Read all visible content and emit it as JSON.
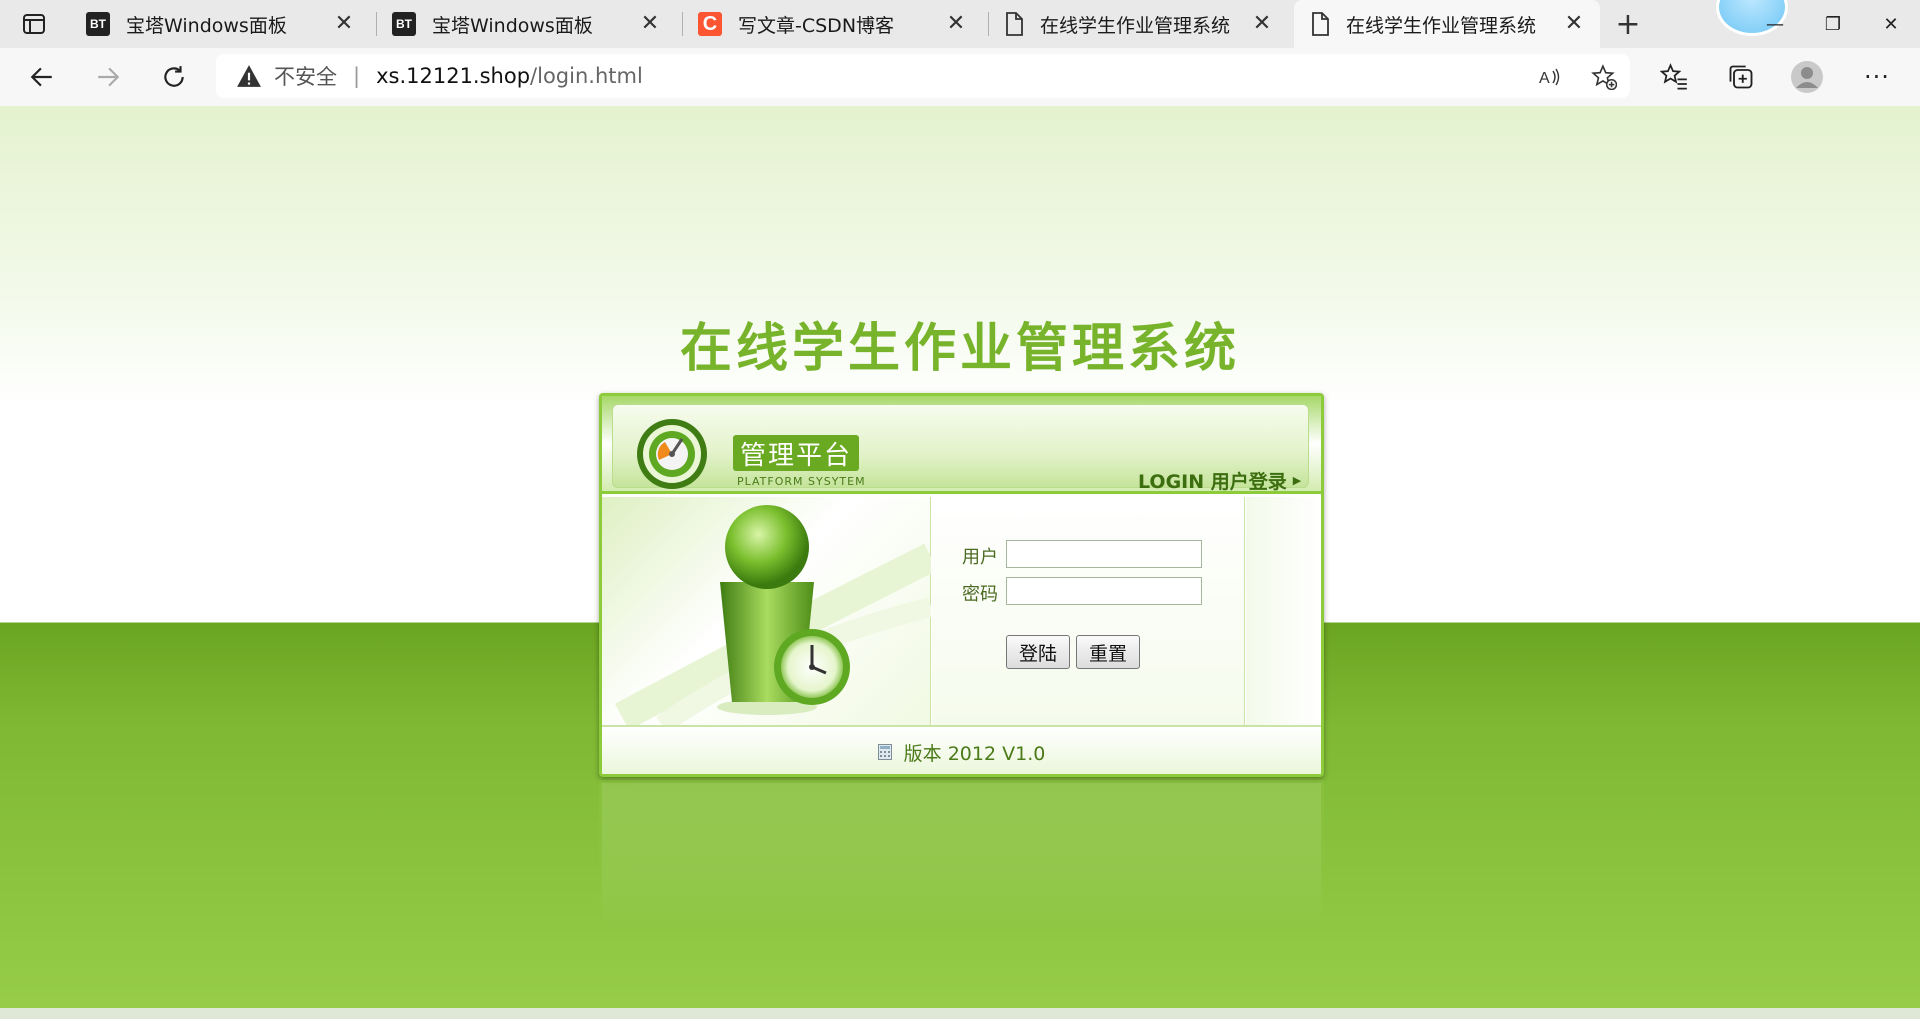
{
  "browser": {
    "tabs": [
      {
        "title": "宝塔Windows面板",
        "favicon": "BT"
      },
      {
        "title": "宝塔Windows面板",
        "favicon": "BT"
      },
      {
        "title": "写文章-CSDN博客",
        "favicon": "C"
      },
      {
        "title": "在线学生作业管理系统",
        "favicon": "document-icon"
      },
      {
        "title": "在线学生作业管理系统",
        "favicon": "document-icon",
        "active": true
      }
    ],
    "address": {
      "security_label": "不安全",
      "host": "xs.12121.shop",
      "path": "/login.html"
    }
  },
  "page": {
    "title": "在线学生作业管理系统",
    "header": {
      "badge": "管理平台",
      "subtitle": "PLATFORM SYSYTEM",
      "login_link": "LOGIN 用户登录"
    },
    "form": {
      "username_label": "用户",
      "password_label": "密码",
      "username_value": "",
      "password_value": "",
      "login_button": "登陆",
      "reset_button": "重置"
    },
    "footer": {
      "version": "版本 2012 V1.0"
    }
  },
  "colors": {
    "title_green": "#78b32c",
    "accent_green": "#6aaa22",
    "background_green": "#7fb934"
  }
}
